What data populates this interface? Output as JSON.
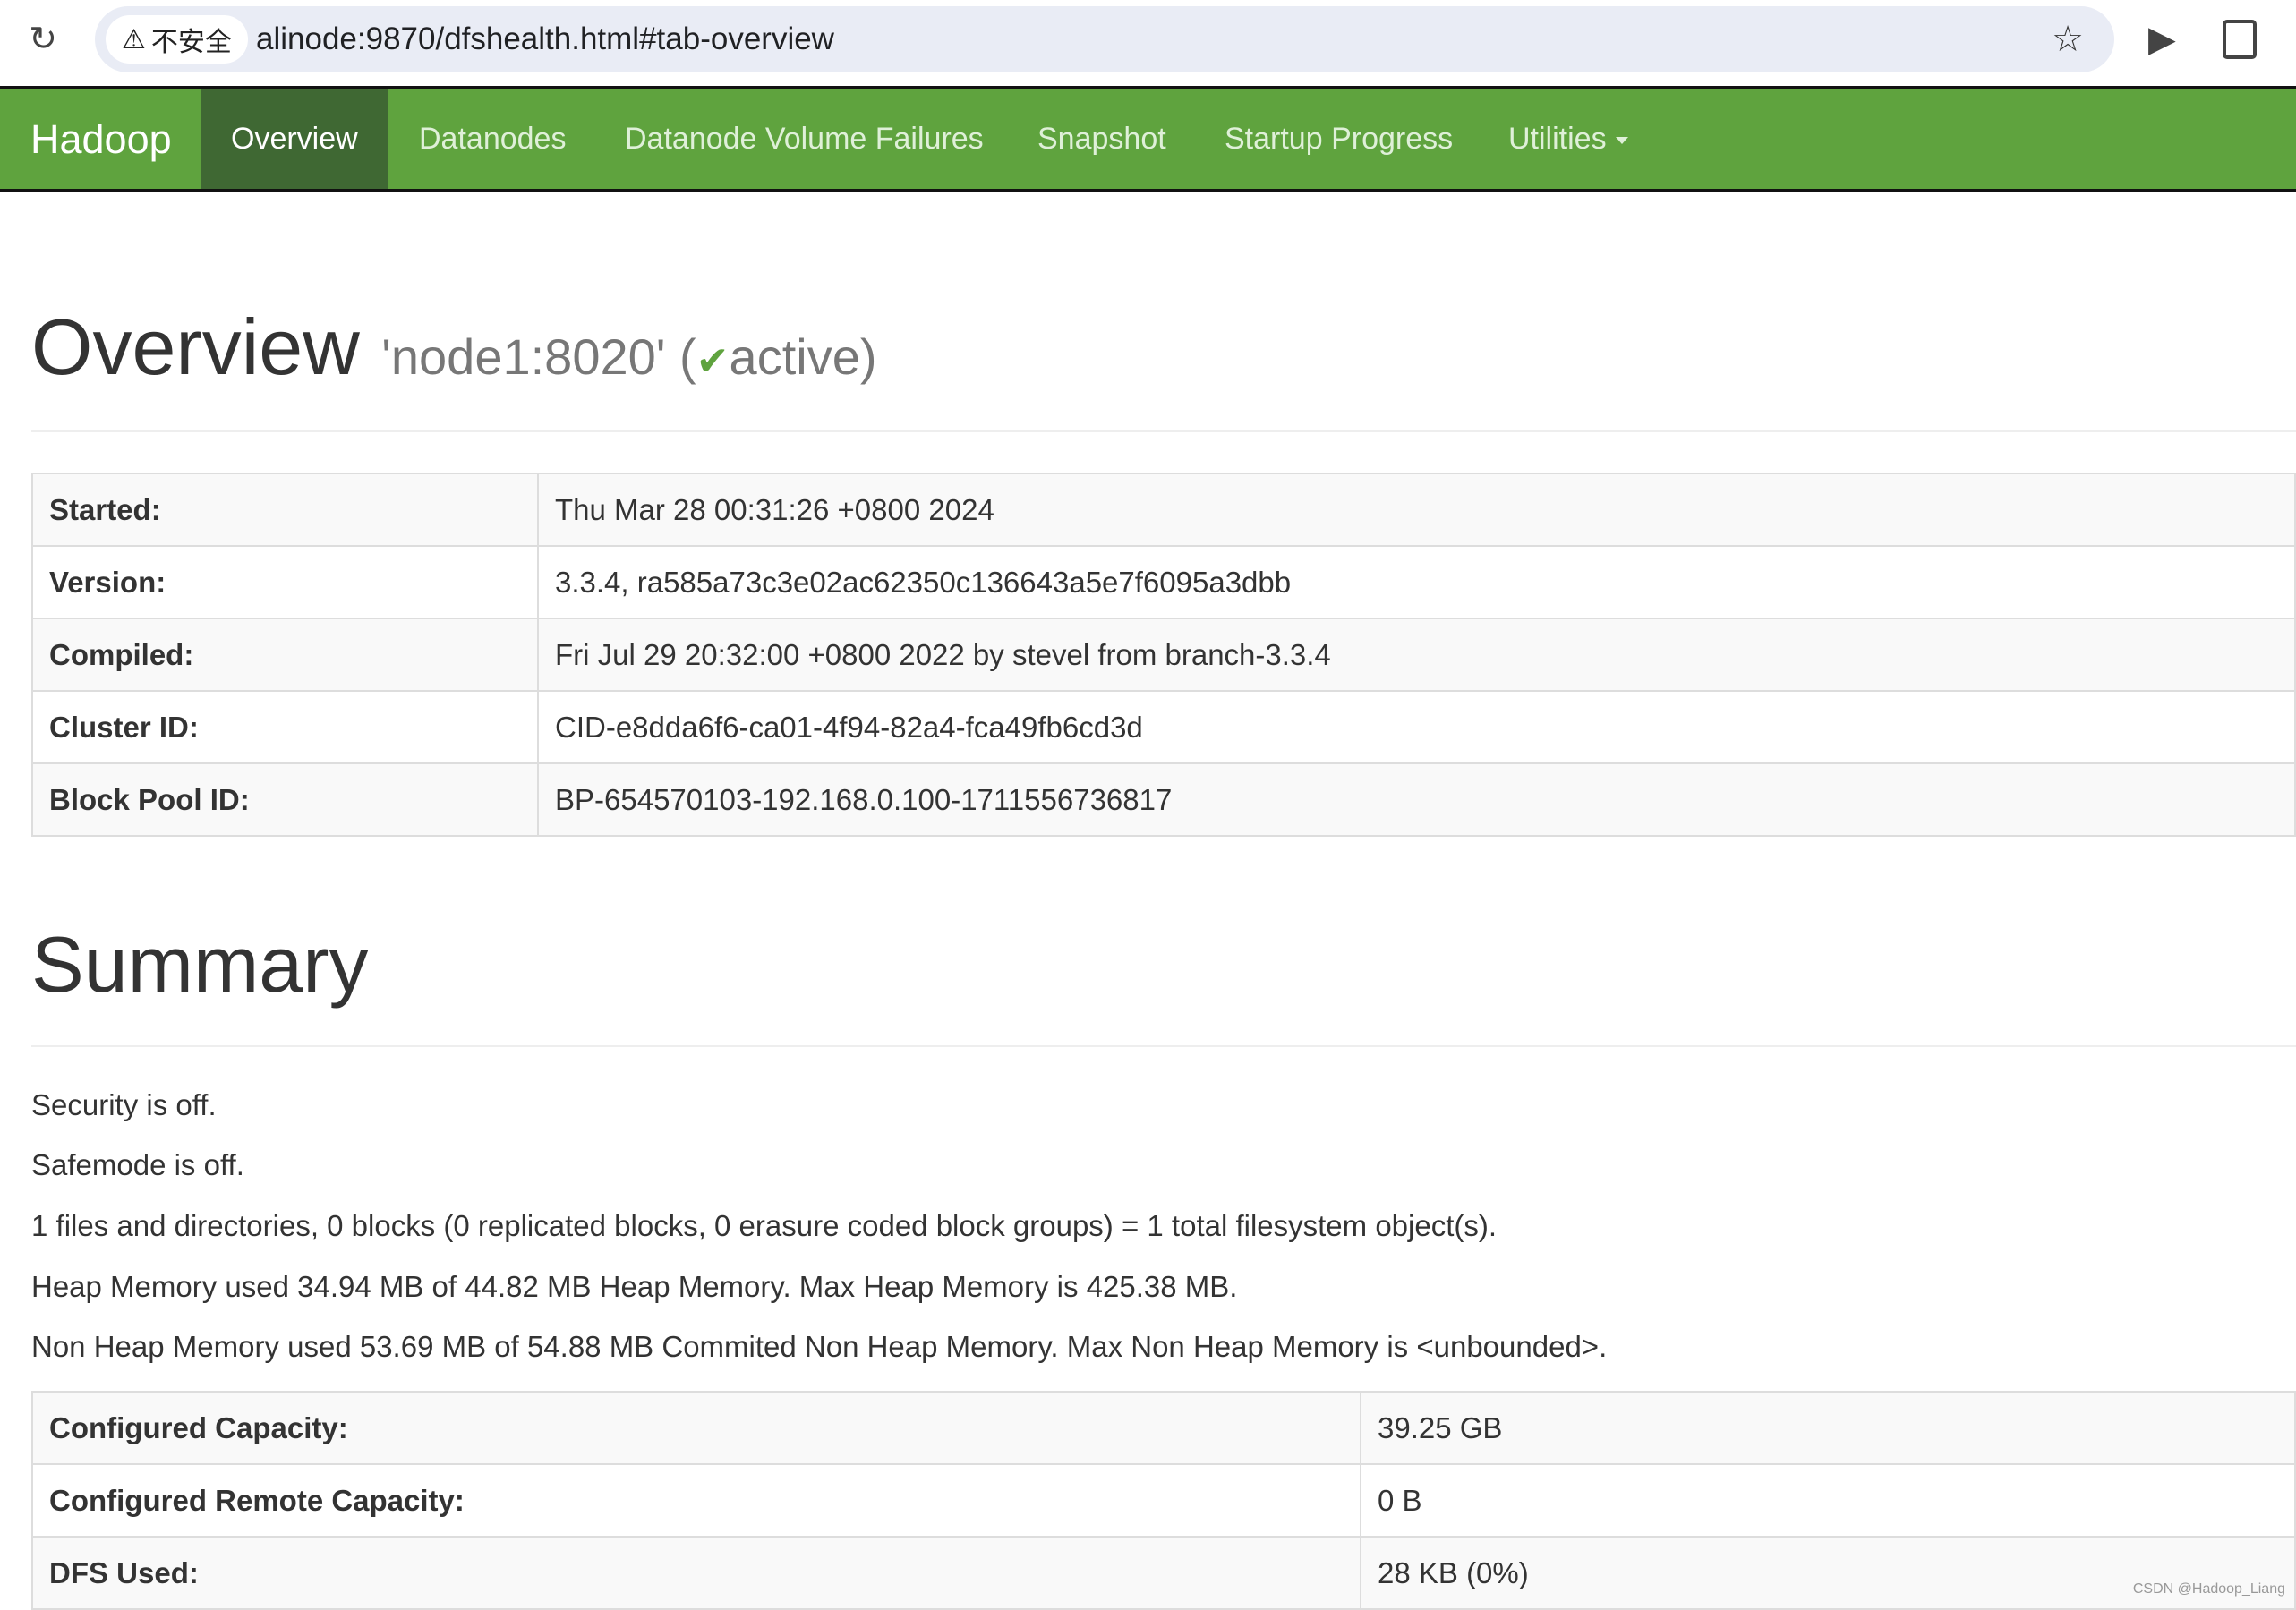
{
  "browser": {
    "security_label": "不安全",
    "url": "alinode:9870/dfshealth.html#tab-overview"
  },
  "navbar": {
    "brand": "Hadoop",
    "items": [
      {
        "label": "Overview",
        "active": true
      },
      {
        "label": "Datanodes"
      },
      {
        "label": "Datanode Volume Failures"
      },
      {
        "label": "Snapshot"
      },
      {
        "label": "Startup Progress"
      },
      {
        "label": "Utilities"
      }
    ]
  },
  "overview": {
    "title": "Overview",
    "node": "'node1:8020'",
    "status_open": "(",
    "status": "active)",
    "rows": [
      {
        "label": "Started:",
        "value": "Thu Mar 28 00:31:26 +0800 2024"
      },
      {
        "label": "Version:",
        "value": "3.3.4, ra585a73c3e02ac62350c136643a5e7f6095a3dbb"
      },
      {
        "label": "Compiled:",
        "value": "Fri Jul 29 20:32:00 +0800 2022 by stevel from branch-3.3.4"
      },
      {
        "label": "Cluster ID:",
        "value": "CID-e8dda6f6-ca01-4f94-82a4-fca49fb6cd3d"
      },
      {
        "label": "Block Pool ID:",
        "value": "BP-654570103-192.168.0.100-1711556736817"
      }
    ]
  },
  "summary": {
    "title": "Summary",
    "lines": [
      "Security is off.",
      "Safemode is off.",
      "1 files and directories, 0 blocks (0 replicated blocks, 0 erasure coded block groups) = 1 total filesystem object(s).",
      "Heap Memory used 34.94 MB of 44.82 MB Heap Memory. Max Heap Memory is 425.38 MB.",
      "Non Heap Memory used 53.69 MB of 54.88 MB Commited Non Heap Memory. Max Non Heap Memory is <unbounded>."
    ],
    "rows": [
      {
        "label": "Configured Capacity:",
        "value": "39.25 GB"
      },
      {
        "label": "Configured Remote Capacity:",
        "value": "0 B"
      },
      {
        "label": "DFS Used:",
        "value": "28 KB (0%)"
      }
    ]
  },
  "watermark": "CSDN @Hadoop_Liang",
  "colors": {
    "navbar": "#5fa33e",
    "navbar_active": "#3f6833",
    "active_check": "#5fa33e"
  }
}
